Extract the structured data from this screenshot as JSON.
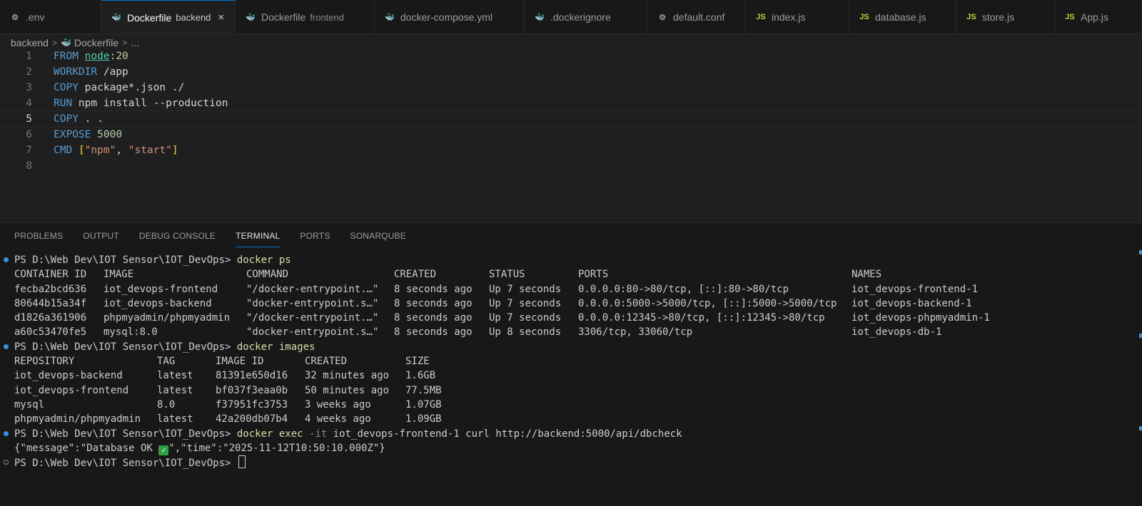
{
  "tabs": [
    {
      "icon": "gear-icon",
      "glyph": "⚙",
      "label": ".env",
      "desc": "",
      "active": false
    },
    {
      "icon": "docker-icon",
      "glyph": "🐳",
      "label": "Dockerfile",
      "desc": "backend",
      "active": true,
      "close": "×"
    },
    {
      "icon": "docker-icon",
      "glyph": "🐳",
      "label": "Dockerfile",
      "desc": "frontend",
      "active": false
    },
    {
      "icon": "docker-compose-icon",
      "glyph": "🐳",
      "label": "docker-compose.yml",
      "desc": "",
      "active": false
    },
    {
      "icon": "dockerignore-icon",
      "glyph": "🐳",
      "label": ".dockerignore",
      "desc": "",
      "active": false
    },
    {
      "icon": "gear-icon",
      "glyph": "⚙",
      "label": "default.conf",
      "desc": "",
      "active": false
    },
    {
      "icon": "js-icon",
      "glyph": "JS",
      "label": "index.js",
      "desc": "",
      "active": false
    },
    {
      "icon": "js-icon",
      "glyph": "JS",
      "label": "database.js",
      "desc": "",
      "active": false
    },
    {
      "icon": "js-icon",
      "glyph": "JS",
      "label": "store.js",
      "desc": "",
      "active": false
    },
    {
      "icon": "js-icon",
      "glyph": "JS",
      "label": "App.js",
      "desc": "",
      "active": false
    }
  ],
  "breadcrumb": {
    "folder": "backend",
    "sep": ">",
    "file": "Dockerfile",
    "more": "..."
  },
  "editor": {
    "line_numbers": [
      "1",
      "2",
      "3",
      "4",
      "5",
      "6",
      "7",
      "8"
    ],
    "current_line": 5,
    "code": {
      "l1": {
        "kw": "FROM",
        "img": "node",
        "colon": ":",
        "ver": "20"
      },
      "l2": {
        "kw": "WORKDIR",
        "rest": " /app"
      },
      "l3": {
        "kw": "COPY",
        "rest": " package*.json ./"
      },
      "l4": {
        "kw": "RUN",
        "rest": " npm install --production"
      },
      "l5": {
        "kw": "COPY",
        "rest": " . ."
      },
      "l6": {
        "kw": "EXPOSE",
        "num": "5000"
      },
      "l7": {
        "kw": "CMD",
        "ob": "[",
        "s1": "\"npm\"",
        "comma": ", ",
        "s2": "\"start\"",
        "cb": "]"
      }
    }
  },
  "panel": {
    "tabs": [
      "PROBLEMS",
      "OUTPUT",
      "DEBUG CONSOLE",
      "TERMINAL",
      "PORTS",
      "SONARQUBE"
    ],
    "active_tab": "TERMINAL"
  },
  "terminal": {
    "prompt": "PS D:\\Web Dev\\IOT Sensor\\IOT_DevOps> ",
    "cmd_ps": "docker ps",
    "ps_headers": [
      "CONTAINER ID",
      "IMAGE",
      "COMMAND",
      "CREATED",
      "STATUS",
      "PORTS",
      "NAMES"
    ],
    "ps_rows": [
      [
        "fecba2bcd636",
        "iot_devops-frontend",
        "\"/docker-entrypoint.…\"",
        "8 seconds ago",
        "Up 7 seconds",
        "0.0.0.0:80->80/tcp, [::]:80->80/tcp",
        "iot_devops-frontend-1"
      ],
      [
        "80644b15a34f",
        "iot_devops-backend",
        "\"docker-entrypoint.s…\"",
        "8 seconds ago",
        "Up 7 seconds",
        "0.0.0.0:5000->5000/tcp, [::]:5000->5000/tcp",
        "iot_devops-backend-1"
      ],
      [
        "d1826a361906",
        "phpmyadmin/phpmyadmin",
        "\"/docker-entrypoint.…\"",
        "8 seconds ago",
        "Up 7 seconds",
        "0.0.0.0:12345->80/tcp, [::]:12345->80/tcp",
        "iot_devops-phpmyadmin-1"
      ],
      [
        "a60c53470fe5",
        "mysql:8.0",
        "\"docker-entrypoint.s…\"",
        "8 seconds ago",
        "Up 8 seconds",
        "3306/tcp, 33060/tcp",
        "iot_devops-db-1"
      ]
    ],
    "cmd_images": "docker images",
    "img_headers": [
      "REPOSITORY",
      "TAG",
      "IMAGE ID",
      "CREATED",
      "SIZE"
    ],
    "img_rows": [
      [
        "iot_devops-backend",
        "latest",
        "81391e650d16",
        "32 minutes ago",
        "1.6GB"
      ],
      [
        "iot_devops-frontend",
        "latest",
        "bf037f3eaa0b",
        "50 minutes ago",
        "77.5MB"
      ],
      [
        "mysql",
        "8.0",
        "f37951fc3753",
        "3 weeks ago",
        "1.07GB"
      ],
      [
        "phpmyadmin/phpmyadmin",
        "latest",
        "42a200db07b4",
        "4 weeks ago",
        "1.09GB"
      ]
    ],
    "cmd_exec": "docker exec",
    "exec_flag": " -it ",
    "exec_rest": "iot_devops-frontend-1 curl http://backend:5000/api/dbcheck",
    "resp_a": "{\"message\":\"Database OK ",
    "resp_check": "✓",
    "resp_b": "\",\"time\":\"2025-11-12T10:50:10.000Z\"}"
  },
  "colors": {
    "accent": "#0078d4",
    "keyword": "#569cd6",
    "string": "#ce9178",
    "command": "#dcdcaa",
    "success_dot": "#3a8ee6"
  }
}
